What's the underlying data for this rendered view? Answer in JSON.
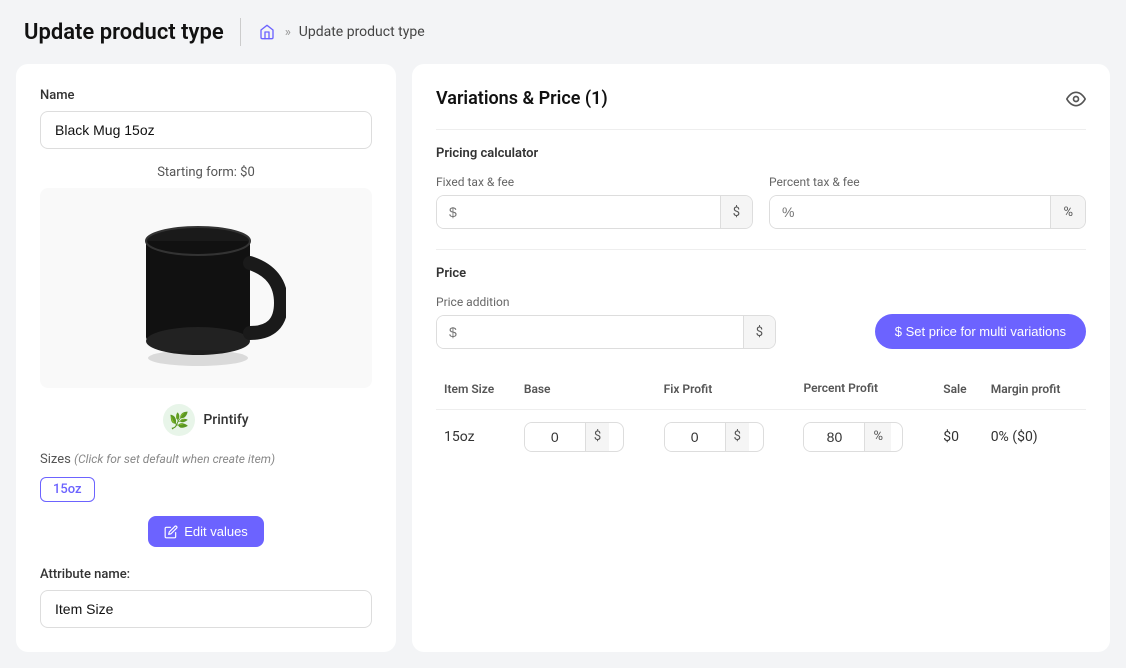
{
  "header": {
    "title": "Update product type",
    "breadcrumb": {
      "home_icon": "🏠",
      "arrow": "»",
      "current": "Update product type"
    }
  },
  "left_panel": {
    "name_label": "Name",
    "name_value": "Black Mug 15oz",
    "starting_form": "Starting form: $0",
    "printify_label": "Printify",
    "sizes_label": "Sizes",
    "sizes_hint": "(Click for set default when create item)",
    "sizes": [
      "15oz"
    ],
    "edit_values_btn": "Edit values",
    "attribute_label": "Attribute name:",
    "attribute_value": "Item Size"
  },
  "right_panel": {
    "variations_title": "Variations & Price (1)",
    "pricing_calculator_label": "Pricing calculator",
    "fixed_tax_label": "Fixed tax & fee",
    "fixed_tax_placeholder": "$",
    "fixed_tax_suffix": "$",
    "percent_tax_label": "Percent tax & fee",
    "percent_tax_placeholder": "%",
    "percent_tax_suffix": "%",
    "price_label": "Price",
    "price_addition_label": "Price addition",
    "price_addition_placeholder": "$",
    "price_addition_suffix": "$",
    "set_price_btn": "$ Set price for multi variations",
    "table": {
      "columns": [
        "Item Size",
        "Base",
        "Fix Profit",
        "Percent Profit",
        "Sale",
        "Margin profit"
      ],
      "rows": [
        {
          "size": "15oz",
          "base": "0",
          "base_suffix": "$",
          "fix_profit": "0",
          "fix_profit_suffix": "$",
          "percent_profit": "80",
          "percent_profit_suffix": "%",
          "sale": "$0",
          "margin_profit": "0% ($0)"
        }
      ]
    }
  }
}
